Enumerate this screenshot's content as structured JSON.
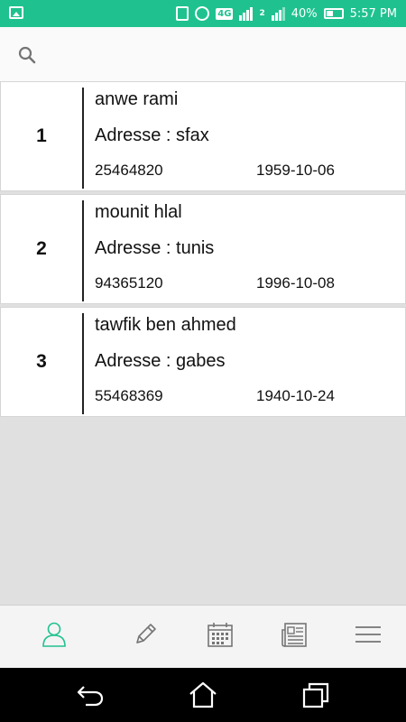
{
  "status_bar": {
    "network": "4G",
    "sim": "2",
    "battery": "40%",
    "time": "5:57 PM"
  },
  "search": {
    "placeholder": ""
  },
  "contacts": [
    {
      "index": "1",
      "name": "anwe rami",
      "address": "Adresse : sfax",
      "phone": "25464820",
      "date": "1959-10-06"
    },
    {
      "index": "2",
      "name": "mounit hlal",
      "address": "Adresse : tunis",
      "phone": "94365120",
      "date": "1996-10-08"
    },
    {
      "index": "3",
      "name": "tawfik ben ahmed",
      "address": "Adresse : gabes",
      "phone": "55468369",
      "date": "1940-10-24"
    }
  ],
  "bottom_tabs": [
    {
      "icon": "user-icon",
      "active": true
    },
    {
      "icon": "pencil-icon",
      "active": false
    },
    {
      "icon": "calendar-icon",
      "active": false
    },
    {
      "icon": "newspaper-icon",
      "active": false
    },
    {
      "icon": "menu-icon",
      "active": false
    }
  ],
  "colors": {
    "accent": "#1fc28f",
    "background": "#e0e0e0"
  }
}
